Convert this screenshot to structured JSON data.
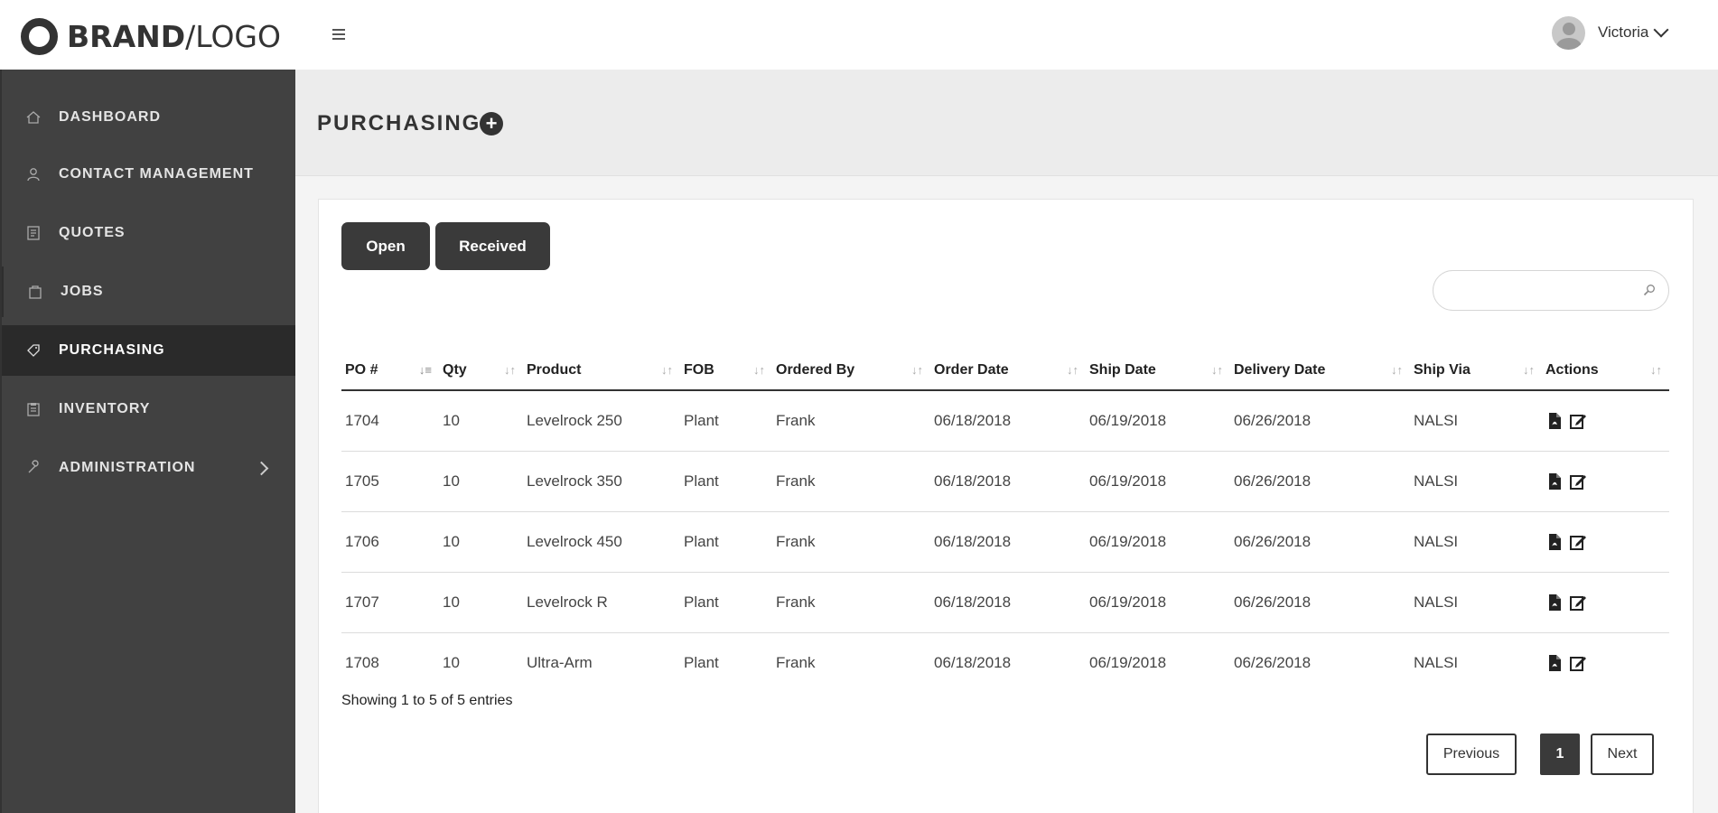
{
  "header": {
    "brand_bold": "BRAND",
    "brand_slash": "/",
    "brand_light": "LOGO",
    "user_name": "Victoria"
  },
  "sidebar": {
    "items": [
      {
        "label": "DASHBOARD",
        "icon": "home-icon"
      },
      {
        "label": "CONTACT MANAGEMENT",
        "icon": "user-icon"
      },
      {
        "label": "QUOTES",
        "icon": "document-icon"
      },
      {
        "label": "JOBS",
        "icon": "bag-icon"
      },
      {
        "label": "PURCHASING",
        "icon": "tag-icon",
        "active": true
      },
      {
        "label": "INVENTORY",
        "icon": "clipboard-icon"
      },
      {
        "label": "ADMINISTRATION",
        "icon": "wrench-icon"
      }
    ]
  },
  "page": {
    "title": "PURCHASING",
    "add_label": "+"
  },
  "filters": {
    "open_label": "Open",
    "received_label": "Received",
    "search_placeholder": ""
  },
  "table": {
    "columns": [
      "PO #",
      "Qty",
      "Product",
      "FOB",
      "Ordered By",
      "Order Date",
      "Ship Date",
      "Delivery Date",
      "Ship Via",
      "Actions"
    ],
    "rows": [
      [
        "1704",
        "10",
        "Levelrock 250",
        "Plant",
        "Frank",
        "06/18/2018",
        "06/19/2018",
        "06/26/2018",
        "NALSI"
      ],
      [
        "1705",
        "10",
        "Levelrock 350",
        "Plant",
        "Frank",
        "06/18/2018",
        "06/19/2018",
        "06/26/2018",
        "NALSI"
      ],
      [
        "1706",
        "10",
        "Levelrock 450",
        "Plant",
        "Frank",
        "06/18/2018",
        "06/19/2018",
        "06/26/2018",
        "NALSI"
      ],
      [
        "1707",
        "10",
        "Levelrock R",
        "Plant",
        "Frank",
        "06/18/2018",
        "06/19/2018",
        "06/26/2018",
        "NALSI"
      ],
      [
        "1708",
        "10",
        "Ultra-Arm",
        "Plant",
        "Frank",
        "06/18/2018",
        "06/19/2018",
        "06/26/2018",
        "NALSI"
      ]
    ]
  },
  "footer": {
    "info": "Showing 1 to 5 of 5 entries",
    "previous_label": "Previous",
    "page_number": "1",
    "next_label": "Next"
  },
  "colors": {
    "sidebar_bg": "#414141",
    "sidebar_active": "#2a2a2a",
    "header_bg": "#ececec",
    "button_dark": "#3a3a3a"
  }
}
